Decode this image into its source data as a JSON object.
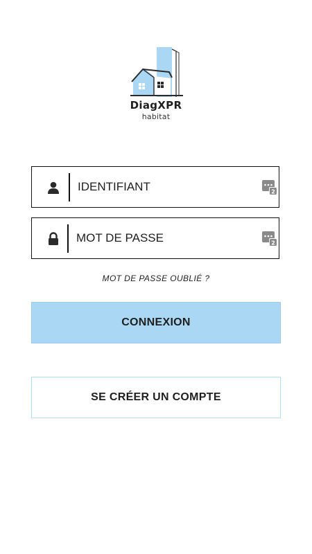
{
  "logo": {
    "name": "DiagXPR",
    "subtitle": "habitat"
  },
  "login_form": {
    "username_placeholder": "IDENTIFIANT",
    "username_value": "",
    "password_placeholder": "MOT DE PASSE",
    "password_value": "",
    "forgot_password": "MOT DE PASSE OUBLIÉ ?",
    "login_button": "CONNEXION",
    "signup_button": "SE CRÉER UN COMPTE"
  },
  "icons": {
    "username": "user-icon",
    "password": "lock-icon",
    "keyboard": "keyboard-icon"
  },
  "colors": {
    "accent": "#a9d7f4",
    "accent_border": "#9ccdee",
    "signup_border": "#aee0f4",
    "text": "#1e1e1e",
    "field_border": "#111111"
  }
}
